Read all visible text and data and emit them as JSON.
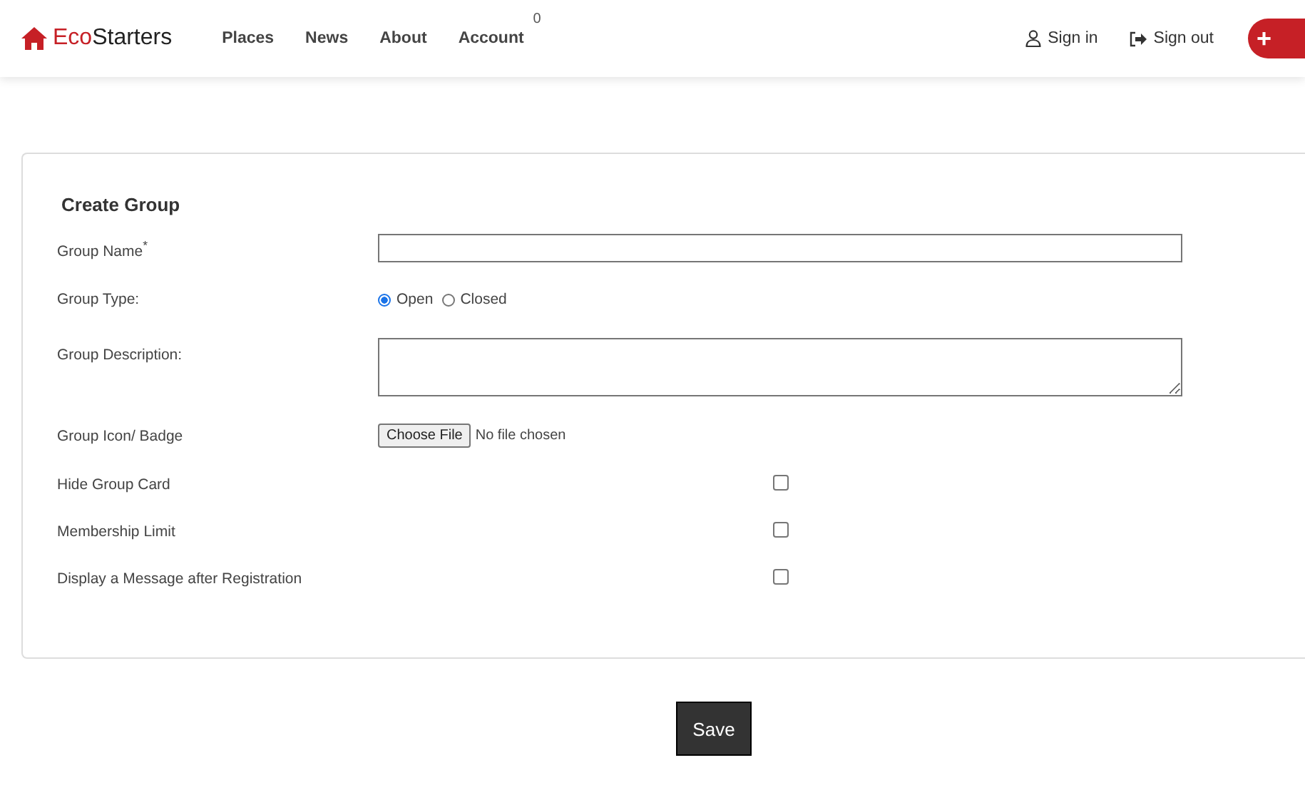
{
  "navbar": {
    "brand_prefix": "Eco",
    "brand_suffix": "Starters",
    "links": [
      {
        "label": "Places"
      },
      {
        "label": "News"
      },
      {
        "label": "About"
      },
      {
        "label": "Account"
      }
    ],
    "account_badge": "0",
    "actions": [
      {
        "kind": "user",
        "label": "Sign in"
      },
      {
        "kind": "exit",
        "label": "Sign out"
      }
    ],
    "add_button": "+"
  },
  "form": {
    "title": "Create Group",
    "fields": [
      {
        "kind": "text",
        "label": "Group Name$^{*}$"
      },
      {
        "kind": "radio",
        "label": "Group Type:",
        "options": [
          {
            "label": "Open",
            "selected": true
          },
          {
            "label": "Closed",
            "selected": false
          }
        ]
      },
      {
        "kind": "textarea",
        "label": "Group Description:"
      },
      {
        "kind": "file",
        "label": "Group Icon/ Badge",
        "button": "Choose File",
        "status": "No file chosen"
      },
      {
        "kind": "checkbox",
        "label": "Hide Group Card",
        "checked": false
      },
      {
        "kind": "checkbox",
        "label": "Membership Limit",
        "checked": false
      },
      {
        "kind": "checkbox",
        "label": "Display a Message after Registration",
        "checked": false
      }
    ]
  },
  "save_button": "Save"
}
